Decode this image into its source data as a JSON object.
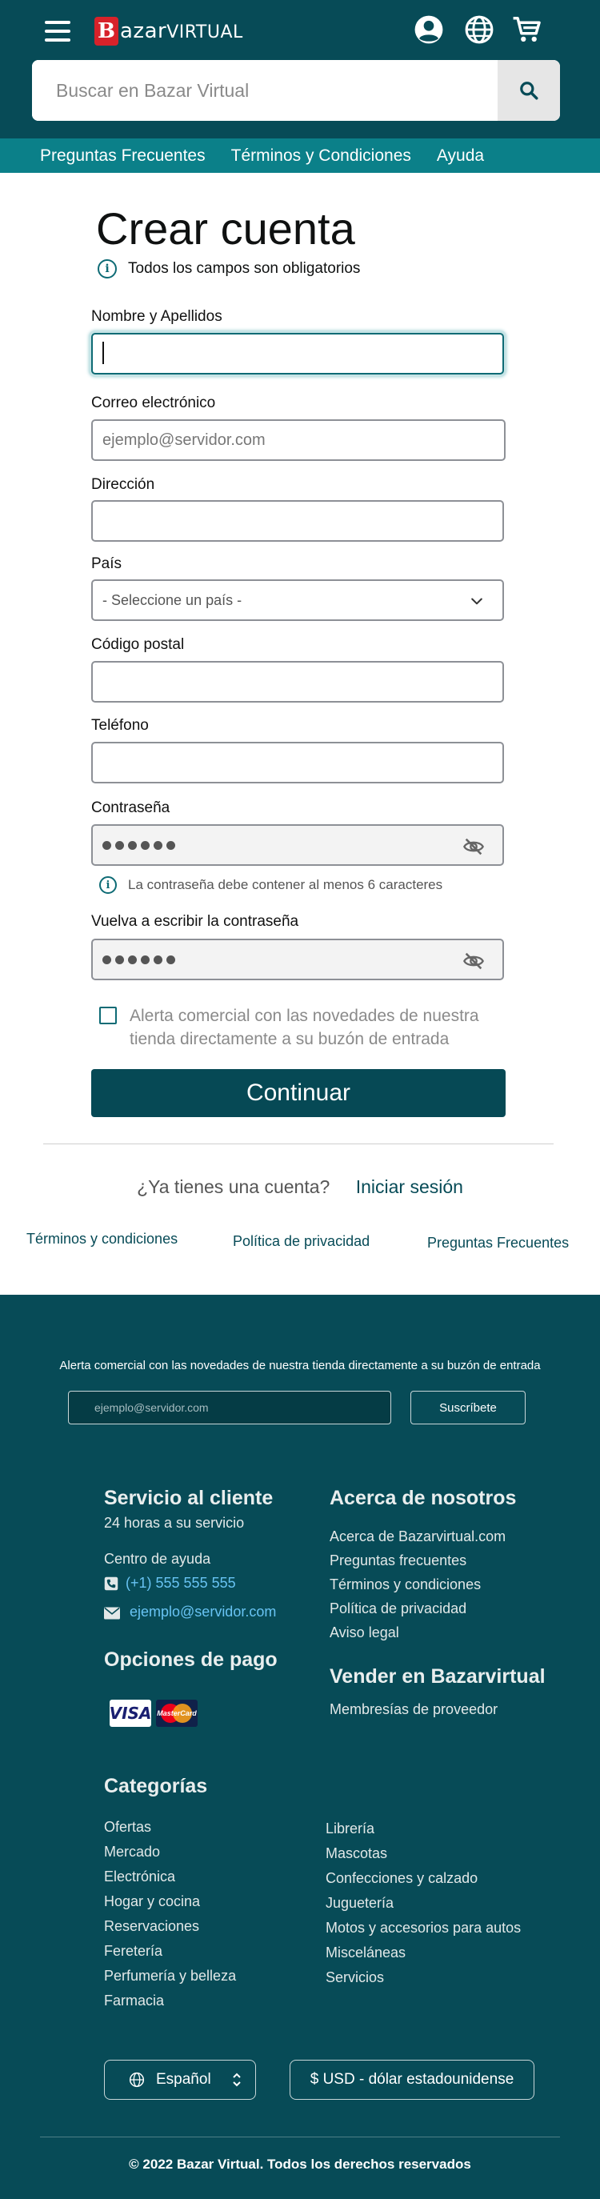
{
  "header": {
    "logo_letter": "B",
    "logo_name": "azar",
    "logo_suffix": "VIRTUAL",
    "search_placeholder": "Buscar en Bazar Virtual",
    "icons": [
      "menu-icon",
      "account-icon",
      "globe-icon",
      "cart-icon",
      "search-icon"
    ]
  },
  "nav": [
    "Preguntas Frecuentes",
    "Términos y Condiciones",
    "Ayuda"
  ],
  "form": {
    "title": "Crear cuenta",
    "required_note": "Todos los campos son obligatorios",
    "name_label": "Nombre y Apellidos",
    "name_value": "",
    "email_label": "Correo electrónico",
    "email_placeholder": "ejemplo@servidor.com",
    "address_label": "Dirección",
    "country_label": "País",
    "country_selected": "- Seleccione un país -",
    "zip_label": "Código postal",
    "phone_label": "Teléfono",
    "password_label": "Contraseña",
    "password_hint": "La contraseña debe contener al menos 6 caracteres",
    "password_confirm_label": "Vuelva a escribir la contraseña",
    "newsletter_checkbox": "Alerta comercial con las novedades de nuestra tienda directamente a su buzón de entrada",
    "newsletter_checked": false,
    "submit_label": "Continuar",
    "have_account": "¿Ya tienes una cuenta?",
    "sign_in": "Iniciar sesión"
  },
  "legal_links": [
    "Términos y condiciones",
    "Política de privacidad",
    "Preguntas Frecuentes"
  ],
  "footer": {
    "newsletter_text": "Alerta comercial con las novedades de nuestra tienda directamente a su buzón de entrada",
    "newsletter_placeholder": "ejemplo@servidor.com",
    "subscribe_label": "Suscríbete",
    "service_title": "Servicio al cliente",
    "service_hours": "24 horas a su servicio",
    "help_center": "Centro de ayuda",
    "phone": "(+1) 555 555 555",
    "email": "ejemplo@servidor.com",
    "payment_title": "Opciones de pago",
    "payment_visa": "VISA",
    "payment_mastercard": "MasterCard",
    "about_title": "Acerca de nosotros",
    "about_links": [
      "Acerca de Bazarvirtual.com",
      "Preguntas frecuentes",
      "Términos y condiciones",
      "Política de privacidad",
      "Aviso legal"
    ],
    "sell_title": "Vender en Bazarvirtual",
    "sell_links": [
      "Membresías de proveedor"
    ],
    "categories_title": "Categorías",
    "categories_left": [
      "Ofertas",
      "Mercado",
      "Electrónica",
      "Hogar y cocina",
      "Reservaciones",
      "Feretería",
      "Perfumería y belleza",
      "Farmacia"
    ],
    "categories_right": [
      "Librería",
      "Mascotas",
      "Confecciones y calzado",
      "Juguetería",
      "Motos y accesorios para autos",
      "Misceláneas",
      "Servicios"
    ],
    "language": "Español",
    "currency": "$ USD - dólar estadounidense",
    "copyright": "© 2022  Bazar Virtual. Todos los derechos reservados"
  },
  "colors": {
    "header_bg": "#074b57",
    "nav_bg": "#0b8089",
    "cta_bg": "#064955",
    "link_blue": "#68c3f3"
  }
}
